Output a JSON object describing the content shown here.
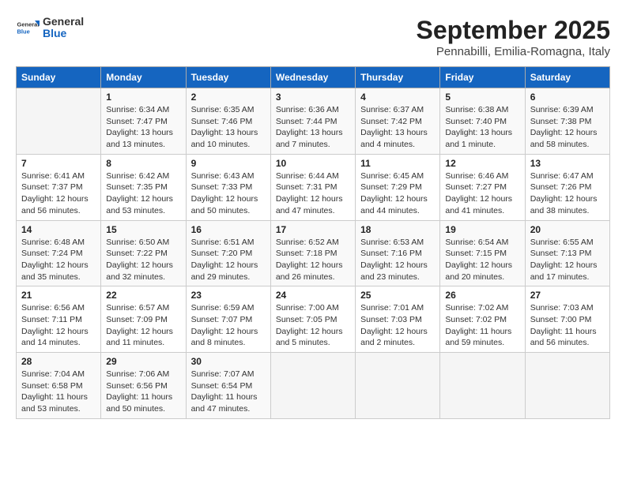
{
  "header": {
    "logo_general": "General",
    "logo_blue": "Blue",
    "month": "September 2025",
    "location": "Pennabilli, Emilia-Romagna, Italy"
  },
  "weekdays": [
    "Sunday",
    "Monday",
    "Tuesday",
    "Wednesday",
    "Thursday",
    "Friday",
    "Saturday"
  ],
  "weeks": [
    [
      {
        "day": "",
        "info": ""
      },
      {
        "day": "1",
        "info": "Sunrise: 6:34 AM\nSunset: 7:47 PM\nDaylight: 13 hours\nand 13 minutes."
      },
      {
        "day": "2",
        "info": "Sunrise: 6:35 AM\nSunset: 7:46 PM\nDaylight: 13 hours\nand 10 minutes."
      },
      {
        "day": "3",
        "info": "Sunrise: 6:36 AM\nSunset: 7:44 PM\nDaylight: 13 hours\nand 7 minutes."
      },
      {
        "day": "4",
        "info": "Sunrise: 6:37 AM\nSunset: 7:42 PM\nDaylight: 13 hours\nand 4 minutes."
      },
      {
        "day": "5",
        "info": "Sunrise: 6:38 AM\nSunset: 7:40 PM\nDaylight: 13 hours\nand 1 minute."
      },
      {
        "day": "6",
        "info": "Sunrise: 6:39 AM\nSunset: 7:38 PM\nDaylight: 12 hours\nand 58 minutes."
      }
    ],
    [
      {
        "day": "7",
        "info": "Sunrise: 6:41 AM\nSunset: 7:37 PM\nDaylight: 12 hours\nand 56 minutes."
      },
      {
        "day": "8",
        "info": "Sunrise: 6:42 AM\nSunset: 7:35 PM\nDaylight: 12 hours\nand 53 minutes."
      },
      {
        "day": "9",
        "info": "Sunrise: 6:43 AM\nSunset: 7:33 PM\nDaylight: 12 hours\nand 50 minutes."
      },
      {
        "day": "10",
        "info": "Sunrise: 6:44 AM\nSunset: 7:31 PM\nDaylight: 12 hours\nand 47 minutes."
      },
      {
        "day": "11",
        "info": "Sunrise: 6:45 AM\nSunset: 7:29 PM\nDaylight: 12 hours\nand 44 minutes."
      },
      {
        "day": "12",
        "info": "Sunrise: 6:46 AM\nSunset: 7:27 PM\nDaylight: 12 hours\nand 41 minutes."
      },
      {
        "day": "13",
        "info": "Sunrise: 6:47 AM\nSunset: 7:26 PM\nDaylight: 12 hours\nand 38 minutes."
      }
    ],
    [
      {
        "day": "14",
        "info": "Sunrise: 6:48 AM\nSunset: 7:24 PM\nDaylight: 12 hours\nand 35 minutes."
      },
      {
        "day": "15",
        "info": "Sunrise: 6:50 AM\nSunset: 7:22 PM\nDaylight: 12 hours\nand 32 minutes."
      },
      {
        "day": "16",
        "info": "Sunrise: 6:51 AM\nSunset: 7:20 PM\nDaylight: 12 hours\nand 29 minutes."
      },
      {
        "day": "17",
        "info": "Sunrise: 6:52 AM\nSunset: 7:18 PM\nDaylight: 12 hours\nand 26 minutes."
      },
      {
        "day": "18",
        "info": "Sunrise: 6:53 AM\nSunset: 7:16 PM\nDaylight: 12 hours\nand 23 minutes."
      },
      {
        "day": "19",
        "info": "Sunrise: 6:54 AM\nSunset: 7:15 PM\nDaylight: 12 hours\nand 20 minutes."
      },
      {
        "day": "20",
        "info": "Sunrise: 6:55 AM\nSunset: 7:13 PM\nDaylight: 12 hours\nand 17 minutes."
      }
    ],
    [
      {
        "day": "21",
        "info": "Sunrise: 6:56 AM\nSunset: 7:11 PM\nDaylight: 12 hours\nand 14 minutes."
      },
      {
        "day": "22",
        "info": "Sunrise: 6:57 AM\nSunset: 7:09 PM\nDaylight: 12 hours\nand 11 minutes."
      },
      {
        "day": "23",
        "info": "Sunrise: 6:59 AM\nSunset: 7:07 PM\nDaylight: 12 hours\nand 8 minutes."
      },
      {
        "day": "24",
        "info": "Sunrise: 7:00 AM\nSunset: 7:05 PM\nDaylight: 12 hours\nand 5 minutes."
      },
      {
        "day": "25",
        "info": "Sunrise: 7:01 AM\nSunset: 7:03 PM\nDaylight: 12 hours\nand 2 minutes."
      },
      {
        "day": "26",
        "info": "Sunrise: 7:02 AM\nSunset: 7:02 PM\nDaylight: 11 hours\nand 59 minutes."
      },
      {
        "day": "27",
        "info": "Sunrise: 7:03 AM\nSunset: 7:00 PM\nDaylight: 11 hours\nand 56 minutes."
      }
    ],
    [
      {
        "day": "28",
        "info": "Sunrise: 7:04 AM\nSunset: 6:58 PM\nDaylight: 11 hours\nand 53 minutes."
      },
      {
        "day": "29",
        "info": "Sunrise: 7:06 AM\nSunset: 6:56 PM\nDaylight: 11 hours\nand 50 minutes."
      },
      {
        "day": "30",
        "info": "Sunrise: 7:07 AM\nSunset: 6:54 PM\nDaylight: 11 hours\nand 47 minutes."
      },
      {
        "day": "",
        "info": ""
      },
      {
        "day": "",
        "info": ""
      },
      {
        "day": "",
        "info": ""
      },
      {
        "day": "",
        "info": ""
      }
    ]
  ]
}
